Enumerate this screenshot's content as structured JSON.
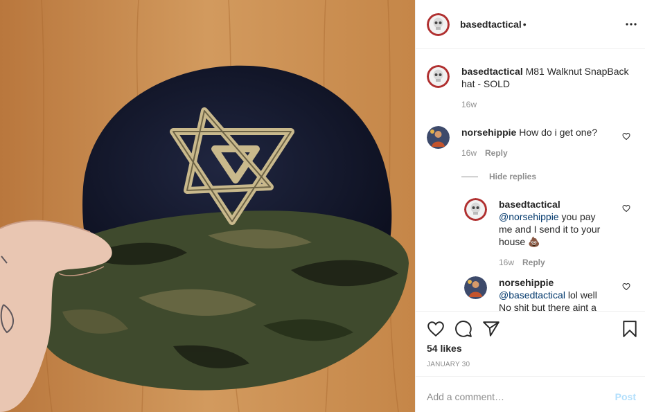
{
  "post": {
    "username": "basedtactical",
    "dot": "•",
    "caption": "M81 Walknut SnapBack hat - SOLD",
    "caption_time": "16w",
    "likes": "54 likes",
    "date": "JANUARY 30"
  },
  "comments": [
    {
      "username": "norsehippie",
      "text": "How do i get one?",
      "time": "16w",
      "reply_label": "Reply",
      "hide_replies": "Hide replies",
      "replies": [
        {
          "username": "basedtactical",
          "mention": "@norsehippie",
          "text": " you pay me and I send it to your house 💩",
          "time": "16w",
          "reply_label": "Reply"
        },
        {
          "username": "norsehippie",
          "mention": "@basedtactical",
          "text": " lol well No shit but there aint a"
        }
      ]
    }
  ],
  "composer": {
    "placeholder": "Add a comment…",
    "post_label": "Post"
  },
  "icons": {
    "more": "more-options-icon",
    "like": "heart-icon",
    "comment": "comment-icon",
    "share": "share-icon",
    "save": "bookmark-icon"
  }
}
